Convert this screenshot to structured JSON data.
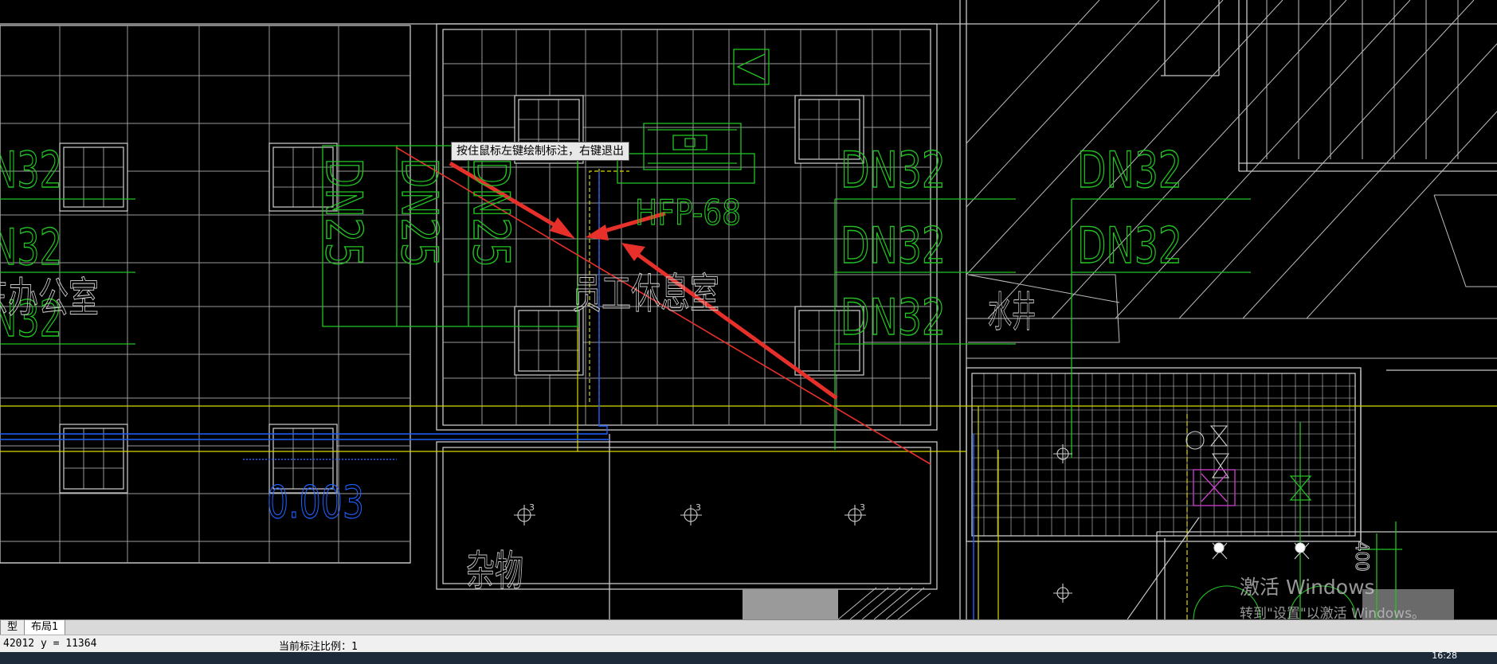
{
  "tooltip": "按住鼠标左键绘制标注，右键退出",
  "pipe_labels": {
    "left_1": "N32",
    "left_2": "N32",
    "left_3": "N32",
    "mid_center_1": "DN32",
    "mid_center_2": "DN32",
    "mid_center_3": "DN32",
    "right_1": "DN32",
    "right_2": "DN32",
    "vertical_1": "DN25",
    "vertical_2": "DN25",
    "vertical_3": "DN25"
  },
  "equipment_label": "HFP-68",
  "rooms": {
    "office": "东办公室",
    "staff_lounge": "员工休息室",
    "storage": "杂物",
    "water_well": "水井"
  },
  "slope": "0.003",
  "side_dimension": "400",
  "tabs": [
    "型",
    "布局1"
  ],
  "status": {
    "coordinates": "42012 y = 11364",
    "scale": "当前标注比例：1"
  },
  "watermark": {
    "title": "激活 Windows",
    "subtitle": "转到\"设置\"以激活 Windows。"
  },
  "clock": "16:28",
  "colors": {
    "background": "#000000",
    "grid": "#c8c8c8",
    "pipe_green": "#22c322",
    "water_blue": "#2060ff",
    "yellow": "#d8d800",
    "arrow_red": "#e8302a",
    "magenta": "#d040d0"
  }
}
